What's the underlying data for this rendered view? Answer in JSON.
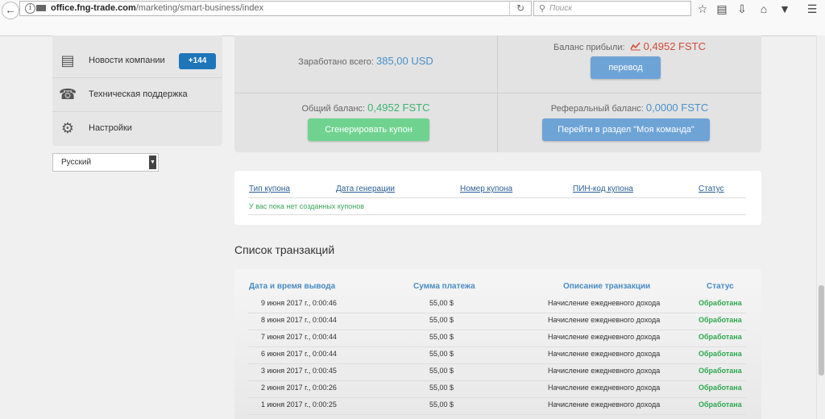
{
  "browser": {
    "url_domain": "office.fng-trade.com",
    "url_path": "/marketing/smart-business/index",
    "search_placeholder": "Поиск"
  },
  "sidebar": {
    "items": [
      {
        "label": "Новости компании",
        "icon": "news-icon",
        "badge": "+144"
      },
      {
        "label": "Техническая поддержка",
        "icon": "headset-icon"
      },
      {
        "label": "Настройки",
        "icon": "gear-icon"
      }
    ],
    "language": "Русский"
  },
  "balances": {
    "earned_label": "Заработано всего:",
    "earned_value": "385,00 USD",
    "profit_label": "Баланс прибыли:",
    "profit_value": "0,4952 FSTC",
    "transfer_button": "перевод",
    "total_label": "Общий баланс:",
    "total_value": "0,4952 FSTC",
    "generate_button": "Сгенерировать купон",
    "referral_label": "Реферальный баланс:",
    "referral_value": "0,0000 FSTC",
    "team_button": "Перейти в раздел \"Моя команда\""
  },
  "coupons": {
    "headers": [
      "Тип купона",
      "Дата генерации",
      "Номер купона",
      "ПИН-код купона",
      "Статус"
    ],
    "empty_message": "У вас пока нет созданных купонов"
  },
  "transactions": {
    "title": "Список транзакций",
    "headers": [
      "Дата и время вывода",
      "Сумма платежа",
      "Описание транзакции",
      "Статус"
    ],
    "rows": [
      {
        "date": "9 июня 2017 г., 0:00:46",
        "amount": "55,00 $",
        "desc": "Начисление ежедневного дохода",
        "status": "Обработана"
      },
      {
        "date": "8 июня 2017 г., 0:00:44",
        "amount": "55,00 $",
        "desc": "Начисление ежедневного дохода",
        "status": "Обработана"
      },
      {
        "date": "7 июня 2017 г., 0:00:44",
        "amount": "55,00 $",
        "desc": "Начисление ежедневного дохода",
        "status": "Обработана"
      },
      {
        "date": "6 июня 2017 г., 0:00:44",
        "amount": "55,00 $",
        "desc": "Начисление ежедневного дохода",
        "status": "Обработана"
      },
      {
        "date": "3 июня 2017 г., 0:00:45",
        "amount": "55,00 $",
        "desc": "Начисление ежедневного дохода",
        "status": "Обработана"
      },
      {
        "date": "2 июня 2017 г., 0:00:26",
        "amount": "55,00 $",
        "desc": "Начисление ежедневного дохода",
        "status": "Обработана"
      },
      {
        "date": "1 июня 2017 г., 0:00:25",
        "amount": "55,00 $",
        "desc": "Начисление ежедневного дохода",
        "status": "Обработана"
      }
    ]
  },
  "colors": {
    "accent_blue": "#1e76b9",
    "value_blue": "#4a90c8",
    "value_green": "#3cb371",
    "value_red": "#d34b3a",
    "status_green": "#2ea84f"
  }
}
